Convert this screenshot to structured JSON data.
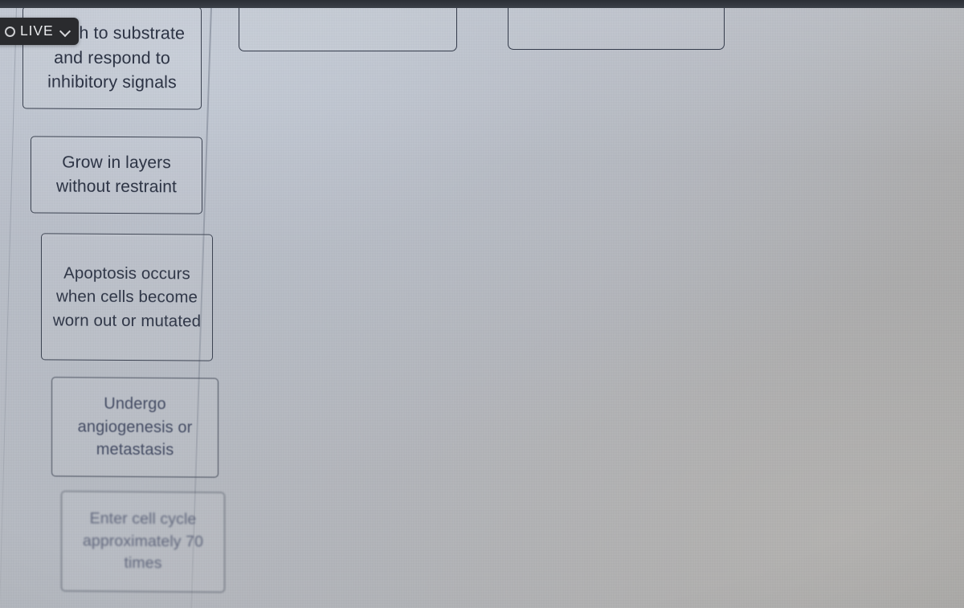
{
  "overlay": {
    "live_badge": {
      "record_icon": "record-circle-icon",
      "label": "LIVE",
      "chevron_icon": "chevron-down-icon"
    }
  },
  "colors": {
    "screen_background": "#b7bdc6",
    "tile_border": "#39404f",
    "tile_text": "#2c3344",
    "dropzone_border": "#333a4a",
    "badge_background": "#2a2b2e",
    "badge_text": "#e9eaec",
    "bezel": "#343840"
  },
  "activity": {
    "tiles": [
      {
        "id": "tile-1",
        "text": "Attach to substrate and respond to inhibitory signals"
      },
      {
        "id": "tile-2",
        "text": "Grow in layers without restraint"
      },
      {
        "id": "tile-3",
        "text": "Apoptosis occurs when cells become worn out or mutated"
      },
      {
        "id": "tile-4",
        "text": "Undergo angiogenesis or metastasis"
      },
      {
        "id": "tile-5",
        "text": "Enter cell cycle approximately 70 times"
      }
    ],
    "dropzones": [
      {
        "id": "dropzone-1",
        "text": ""
      },
      {
        "id": "dropzone-2",
        "text": ""
      }
    ]
  }
}
